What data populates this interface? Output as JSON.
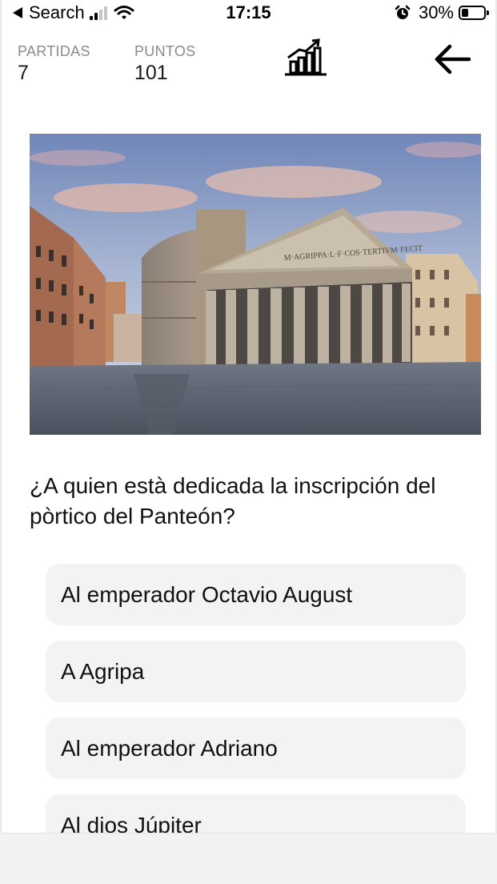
{
  "status_bar": {
    "back_label": "Search",
    "time": "17:15",
    "battery_text": "30%",
    "battery_level": 0.3
  },
  "stats": {
    "games_label": "PARTIDAS",
    "games_value": "7",
    "points_label": "PUNTOS",
    "points_value": "101",
    "chart_icon": "bar-chart-trend-icon",
    "back_icon": "arrow-left-icon"
  },
  "image": {
    "inscription": "M·AGRIPPA·L·F·COS·TERTIVM·FECIT"
  },
  "question": {
    "text": "¿A quien està dedicada la inscripción del pòrtico del Panteón?"
  },
  "answers": [
    {
      "label": "Al emperador Octavio August"
    },
    {
      "label": "A Agripa"
    },
    {
      "label": "Al emperador Adriano"
    },
    {
      "label": "Al dios Júpiter"
    }
  ],
  "colors": {
    "answer_bg": "#f3f3f3",
    "stat_label": "#8a8a8a",
    "bottom_bar": "#f2f2f2"
  }
}
